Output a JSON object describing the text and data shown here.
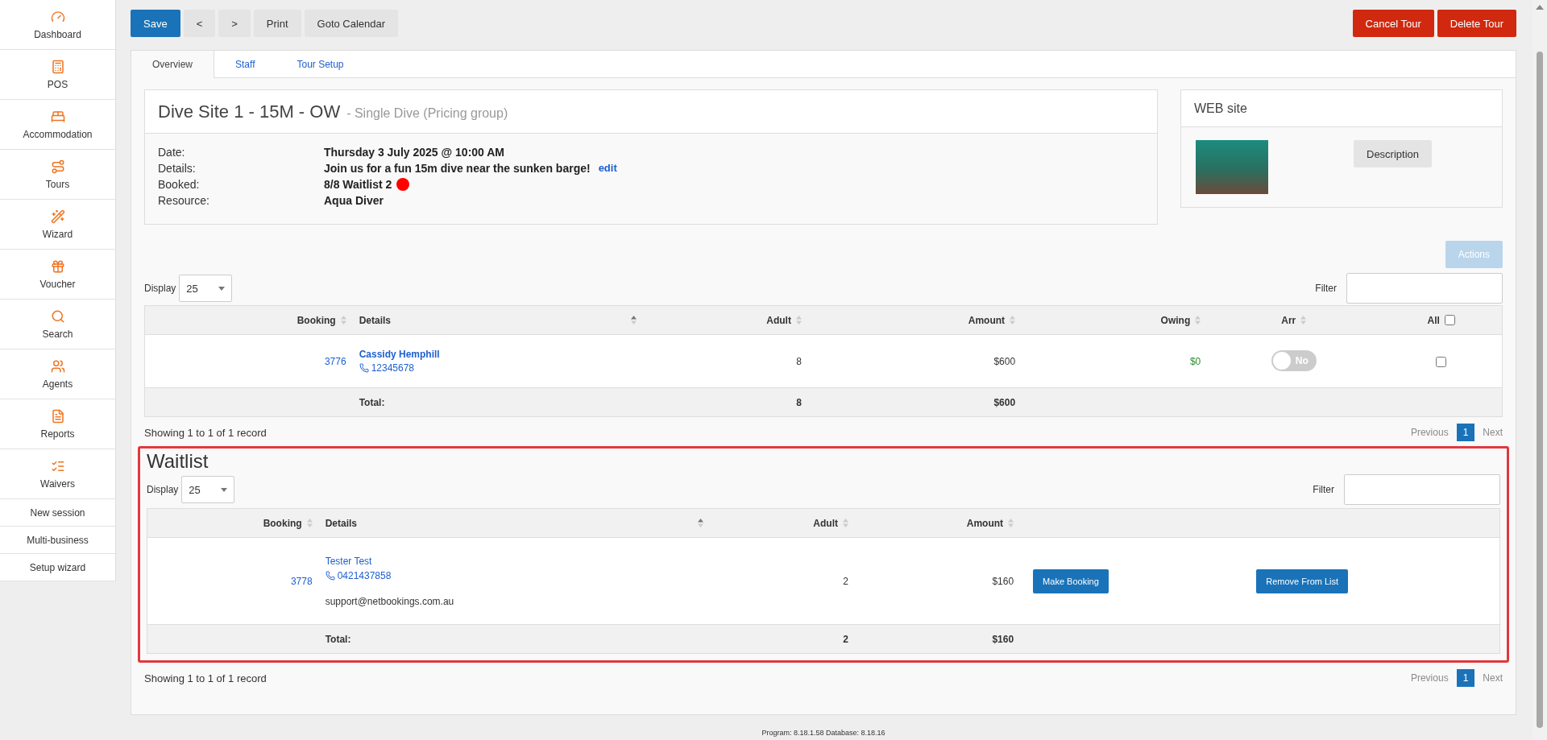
{
  "sidebar": {
    "items": [
      {
        "label": "Dashboard",
        "kind": "icon"
      },
      {
        "label": "POS",
        "kind": "icon"
      },
      {
        "label": "Accommodation",
        "kind": "icon"
      },
      {
        "label": "Tours",
        "kind": "icon"
      },
      {
        "label": "Wizard",
        "kind": "icon"
      },
      {
        "label": "Voucher",
        "kind": "icon"
      },
      {
        "label": "Search",
        "kind": "icon"
      },
      {
        "label": "Agents",
        "kind": "icon"
      },
      {
        "label": "Reports",
        "kind": "icon"
      },
      {
        "label": "Waivers",
        "kind": "icon"
      },
      {
        "label": "New session",
        "kind": "text"
      },
      {
        "label": "Multi-business",
        "kind": "text"
      },
      {
        "label": "Setup wizard",
        "kind": "text"
      }
    ]
  },
  "toolbar": {
    "left": [
      {
        "label": "Save",
        "kind": "primary"
      },
      {
        "label": "<",
        "kind": "default"
      },
      {
        "label": ">",
        "kind": "default"
      },
      {
        "label": "Print",
        "kind": "default"
      },
      {
        "label": "Goto Calendar",
        "kind": "default"
      }
    ],
    "right": [
      {
        "label": "Cancel Tour",
        "kind": "danger"
      },
      {
        "label": "Delete Tour",
        "kind": "danger"
      }
    ]
  },
  "tabs": [
    {
      "label": "Overview",
      "selected": true
    },
    {
      "label": "Staff",
      "selected": false
    },
    {
      "label": "Tour Setup",
      "selected": false
    }
  ],
  "tour": {
    "title": "Dive Site 1 - 15M - OW",
    "subtitle": "- Single Dive (Pricing group)",
    "fields": [
      {
        "label": "Date:",
        "value": "Thursday 3 July 2025 @ 10:00 AM"
      },
      {
        "label": "Details:",
        "value": "Join us for a fun 15m dive near the sunken barge!",
        "link": "edit"
      },
      {
        "label": "Booked:",
        "value": "8/8 Waitlist 2",
        "color": "#ff0000"
      },
      {
        "label": "Resource:",
        "value": "Aqua Diver"
      }
    ]
  },
  "web_site": {
    "title": "WEB site",
    "button": "Description"
  },
  "actions_button": {
    "label": "Actions",
    "disabled": true
  },
  "bookings": {
    "display_label": "Display",
    "page_size": "25",
    "filter_label": "Filter",
    "columns": [
      {
        "label": "Booking",
        "kind": "sortable",
        "sorted": false
      },
      {
        "label": "Details",
        "kind": "sortable",
        "sorted": true
      },
      {
        "label": "Adult",
        "kind": "sortable",
        "sorted": false
      },
      {
        "label": "Amount",
        "kind": "sortable",
        "sorted": false
      },
      {
        "label": "Owing",
        "kind": "sortable",
        "sorted": false
      },
      {
        "label": "Arr",
        "kind": "sortable",
        "sorted": false
      },
      {
        "label": "All",
        "kind": "checkbox",
        "checked": false
      }
    ],
    "rows": [
      {
        "booking": "3776",
        "name": "Cassidy Hemphill",
        "phone": "12345678",
        "adult": "8",
        "amount": "$600",
        "owing": "$0",
        "arrived": {
          "label": "No",
          "on": false
        },
        "selected": false
      }
    ],
    "totals": {
      "label": "Total:",
      "adult": "8",
      "amount": "$600"
    },
    "showing": "Showing 1 to 1 of 1 record",
    "pagination": {
      "previous": "Previous",
      "pages": [
        {
          "label": "1",
          "selected": true
        }
      ],
      "next": "Next"
    }
  },
  "waitlist": {
    "title": "Waitlist",
    "highlighted": true,
    "display_label": "Display",
    "page_size": "25",
    "filter_label": "Filter",
    "columns": [
      {
        "label": "Booking",
        "kind": "sortable",
        "sorted": false
      },
      {
        "label": "Details",
        "kind": "sortable",
        "sorted": true
      },
      {
        "label": "Adult",
        "kind": "sortable",
        "sorted": false
      },
      {
        "label": "Amount",
        "kind": "sortable",
        "sorted": false
      }
    ],
    "rows": [
      {
        "booking": "3778",
        "name": "Tester Test",
        "phone": "0421437858",
        "email": "support@netbookings.com.au",
        "adult": "2",
        "amount": "$160",
        "actions": [
          "Make Booking",
          "Remove From List"
        ]
      }
    ],
    "totals": {
      "label": "Total:",
      "adult": "2",
      "amount": "$160"
    },
    "showing": "Showing 1 to 1 of 1 record",
    "pagination": {
      "previous": "Previous",
      "pages": [
        {
          "label": "1",
          "selected": true
        }
      ],
      "next": "Next"
    }
  },
  "footer": "Program: 8.18.1.58 Database: 8.18.16"
}
